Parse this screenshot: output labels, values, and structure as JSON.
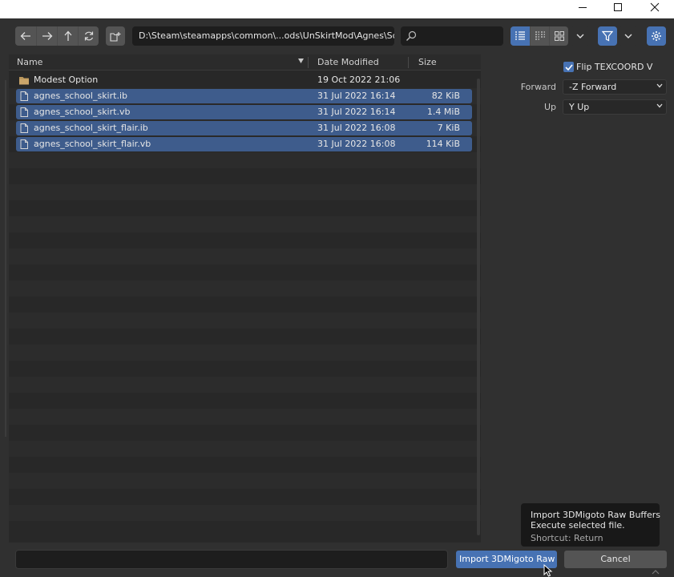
{
  "window": {
    "controls": [
      "minimize-icon",
      "maximize-icon",
      "close-icon"
    ]
  },
  "toolbar": {
    "nav_icons": [
      "back-arrow-icon",
      "forward-arrow-icon",
      "parent-directory-icon",
      "refresh-icon"
    ],
    "new_folder_icon": "new-folder-icon",
    "path": "D:\\Steam\\steamapps\\common\\...ods\\UnSkirtMod\\Agnes\\School\\",
    "search_placeholder": "",
    "display_modes": [
      "vertical-list-icon",
      "horizontal-list-icon",
      "thumbnails-icon"
    ],
    "active_display_mode": "vertical-list-icon",
    "filter_active": true,
    "settings_active": true
  },
  "file_list": {
    "columns": {
      "name": "Name",
      "date": "Date Modified",
      "size": "Size"
    },
    "rows": [
      {
        "type": "folder",
        "name": "Modest Option",
        "date": "19 Oct 2022 21:06",
        "size": "",
        "selected": false
      },
      {
        "type": "file",
        "name": "agnes_school_skirt.ib",
        "date": "31 Jul 2022 16:14",
        "size": "82 KiB",
        "selected": true
      },
      {
        "type": "file",
        "name": "agnes_school_skirt.vb",
        "date": "31 Jul 2022 16:14",
        "size": "1.4 MiB",
        "selected": true
      },
      {
        "type": "file",
        "name": "agnes_school_skirt_flair.ib",
        "date": "31 Jul 2022 16:08",
        "size": "7 KiB",
        "selected": true
      },
      {
        "type": "file",
        "name": "agnes_school_skirt_flair.vb",
        "date": "31 Jul 2022 16:08",
        "size": "114 KiB",
        "selected": true
      }
    ]
  },
  "options": {
    "flip_texcoord": {
      "label": "Flip TEXCOORD V",
      "checked": true
    },
    "forward": {
      "label": "Forward",
      "value": "-Z Forward"
    },
    "up": {
      "label": "Up",
      "value": "Y Up"
    }
  },
  "bottom": {
    "filename_value": "",
    "import_label": "Import 3DMigoto Raw ...",
    "cancel_label": "Cancel"
  },
  "tooltip": {
    "title": "Import 3DMigoto Raw Buffers",
    "description": "Execute selected file.",
    "shortcut": "Shortcut: Return"
  },
  "colors": {
    "accent": "#4772b3",
    "selection": "#3e5c8c",
    "background": "#303030"
  }
}
